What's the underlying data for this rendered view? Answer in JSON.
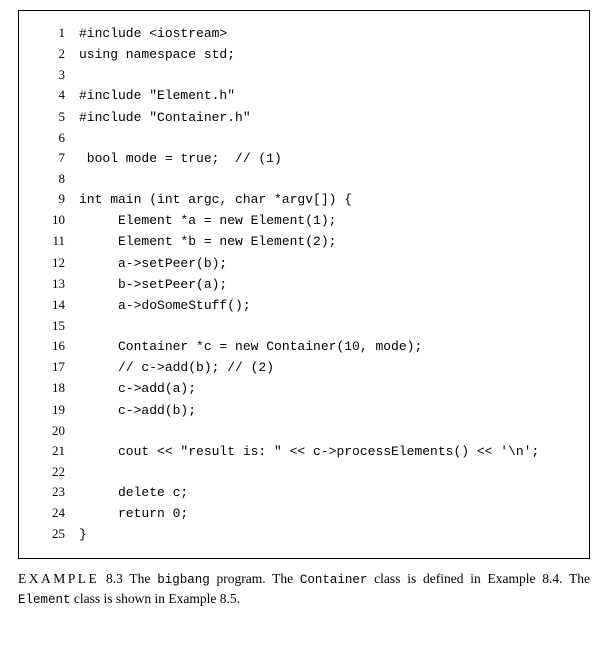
{
  "code": {
    "lines": [
      {
        "n": "1",
        "t": "#include <iostream>"
      },
      {
        "n": "2",
        "t": "using namespace std;"
      },
      {
        "n": "3",
        "t": ""
      },
      {
        "n": "4",
        "t": "#include \"Element.h\""
      },
      {
        "n": "5",
        "t": "#include \"Container.h\""
      },
      {
        "n": "6",
        "t": ""
      },
      {
        "n": "7",
        "t": " bool mode = true;  // (1)"
      },
      {
        "n": "8",
        "t": ""
      },
      {
        "n": "9",
        "t": "int main (int argc, char *argv[]) {"
      },
      {
        "n": "10",
        "t": "     Element *a = new Element(1);"
      },
      {
        "n": "11",
        "t": "     Element *b = new Element(2);"
      },
      {
        "n": "12",
        "t": "     a->setPeer(b);"
      },
      {
        "n": "13",
        "t": "     b->setPeer(a);"
      },
      {
        "n": "14",
        "t": "     a->doSomeStuff();"
      },
      {
        "n": "15",
        "t": ""
      },
      {
        "n": "16",
        "t": "     Container *c = new Container(10, mode);"
      },
      {
        "n": "17",
        "t": "     // c->add(b); // (2)"
      },
      {
        "n": "18",
        "t": "     c->add(a);"
      },
      {
        "n": "19",
        "t": "     c->add(b);"
      },
      {
        "n": "20",
        "t": ""
      },
      {
        "n": "21",
        "t": "     cout << \"result is: \" << c->processElements() << '\\n';"
      },
      {
        "n": "22",
        "t": ""
      },
      {
        "n": "23",
        "t": "     delete c;"
      },
      {
        "n": "24",
        "t": "     return 0;"
      },
      {
        "n": "25",
        "t": "}"
      }
    ]
  },
  "caption": {
    "label": "EXAMPLE",
    "number": "8.3",
    "part1": " The ",
    "prog": "bigbang",
    "part2": " program. The ",
    "cls1": "Container",
    "part3": " class is defined in Example 8.4. The ",
    "cls2": "Element",
    "part4": " class is shown in Example 8.5."
  }
}
